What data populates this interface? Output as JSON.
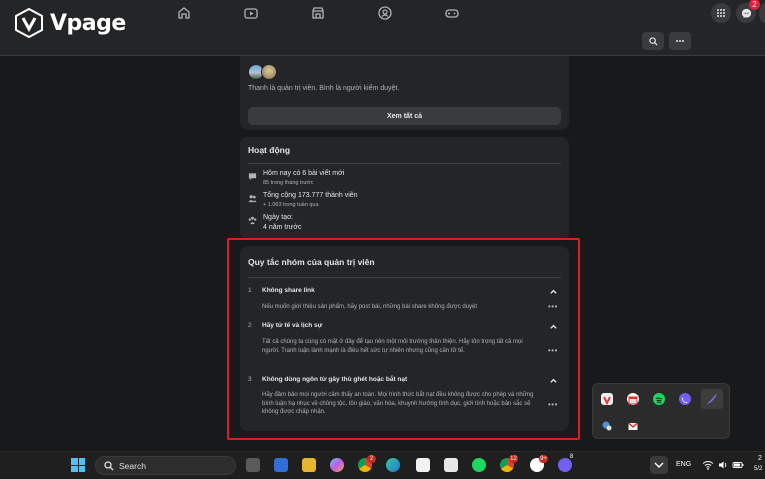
{
  "header": {
    "brand": "Vpage",
    "messenger_badge": "2"
  },
  "admins_card": {
    "text": "Thanh là quản trị viên. Bình là người kiểm duyệt.",
    "see_all_label": "Xem tất cả"
  },
  "activity": {
    "title": "Hoạt động",
    "items": [
      {
        "icon": "post-icon",
        "main": "Hôm nay có 6 bài viết mới",
        "sub": "85 trong tháng trước"
      },
      {
        "icon": "members-icon",
        "main": "Tổng cộng 173.777 thành viên",
        "sub": "+ 1.063 trong tuần qua"
      },
      {
        "icon": "group-icon",
        "main": "Ngày tạo:",
        "sub": "4 năm trước"
      }
    ]
  },
  "rules": {
    "title": "Quy tắc nhóm của quản trị viên",
    "items": [
      {
        "num": "1",
        "title": "Không share link",
        "desc": "Nếu muốn giới thiệu sản phẩm, hãy post bài, những bài share không được duyệt"
      },
      {
        "num": "2",
        "title": "Hãy tử tế và lịch sự",
        "desc": "Tất cả chúng ta cùng có mặt ở đây để tạo nên một môi trường thân thiện. Hãy tôn trọng tất cả mọi người. Tranh luận lành mạnh là điều hết sức tự nhiên nhưng cũng cần tử tế."
      },
      {
        "num": "3",
        "title": "Không dùng ngôn từ gây thù ghét hoặc bắt nạt",
        "desc": "Hãy đảm bảo mọi người cảm thấy an toàn. Mọi hình thức bắt nạt đều không được cho phép và những bình luận hạ nhục về chủng tộc, tôn giáo, văn hóa, khuynh hướng tình dục, giới tính hoặc bản sắc sẽ không được chấp nhận."
      }
    ]
  },
  "taskbar": {
    "search_label": "Search",
    "language": "ENG",
    "chrome_badge": "2",
    "app_badge_1": "12",
    "app_badge_2": "9+",
    "app_badge_3": "8",
    "clock_fragment": "2",
    "date_fragment": "5/2"
  },
  "colors": {
    "background": "#18191a",
    "card": "#242526",
    "highlight_border": "#e01b1b",
    "windows_accent": "#4cc2ff"
  }
}
